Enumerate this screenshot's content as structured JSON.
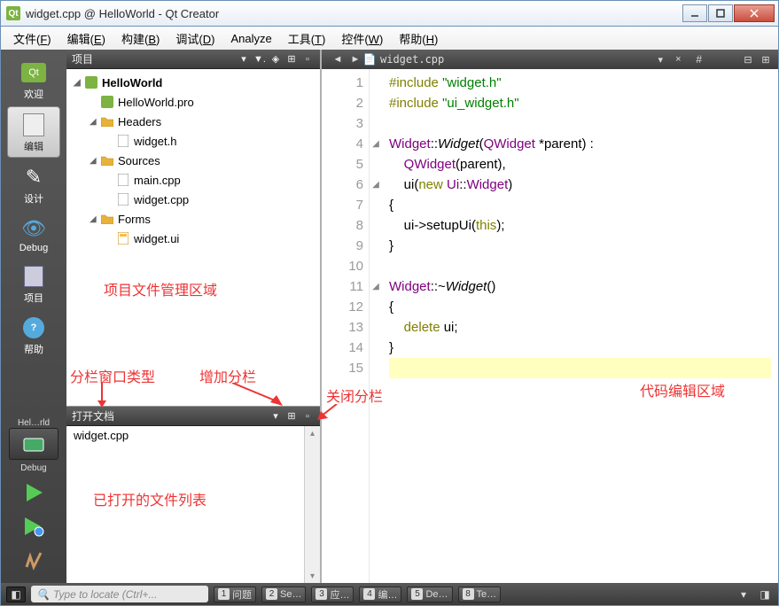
{
  "window": {
    "title": "widget.cpp @ HelloWorld - Qt Creator"
  },
  "menus": [
    {
      "label": "文件",
      "key": "F"
    },
    {
      "label": "编辑",
      "key": "E"
    },
    {
      "label": "构建",
      "key": "B"
    },
    {
      "label": "调试",
      "key": "D"
    },
    {
      "label": "Analyze",
      "key": ""
    },
    {
      "label": "工具",
      "key": "T"
    },
    {
      "label": "控件",
      "key": "W"
    },
    {
      "label": "帮助",
      "key": "H"
    }
  ],
  "modes": [
    {
      "id": "welcome",
      "label": "欢迎"
    },
    {
      "id": "edit",
      "label": "编辑",
      "active": true
    },
    {
      "id": "design",
      "label": "设计"
    },
    {
      "id": "debug",
      "label": "Debug"
    },
    {
      "id": "projects",
      "label": "项目"
    },
    {
      "id": "help",
      "label": "帮助"
    }
  ],
  "target": {
    "kit": "Hel…rld",
    "config": "Debug"
  },
  "project_pane": {
    "title": "项目",
    "tree": [
      {
        "lvl": 0,
        "exp": true,
        "icon": "qt",
        "label": "HelloWorld",
        "bold": true
      },
      {
        "lvl": 1,
        "exp": false,
        "icon": "pro",
        "label": "HelloWorld.pro"
      },
      {
        "lvl": 1,
        "exp": true,
        "icon": "folder",
        "label": "Headers"
      },
      {
        "lvl": 2,
        "exp": false,
        "icon": "h",
        "label": "widget.h"
      },
      {
        "lvl": 1,
        "exp": true,
        "icon": "folder",
        "label": "Sources"
      },
      {
        "lvl": 2,
        "exp": false,
        "icon": "cpp",
        "label": "main.cpp"
      },
      {
        "lvl": 2,
        "exp": false,
        "icon": "cpp",
        "label": "widget.cpp"
      },
      {
        "lvl": 1,
        "exp": true,
        "icon": "folder",
        "label": "Forms"
      },
      {
        "lvl": 2,
        "exp": false,
        "icon": "ui",
        "label": "widget.ui"
      }
    ]
  },
  "open_docs": {
    "title": "打开文档",
    "items": [
      "widget.cpp"
    ]
  },
  "annotations": {
    "proj_area": "项目文件管理区域",
    "pane_type": "分栏窗口类型",
    "add_split": "增加分栏",
    "close_split": "关闭分栏",
    "open_list": "已打开的文件列表",
    "code_area": "代码编辑区域"
  },
  "editor": {
    "filename": "widget.cpp",
    "hash": "#",
    "lines": [
      {
        "n": 1,
        "html": "<span class='kw'>#include</span> <span class='str'>\"widget.h\"</span>"
      },
      {
        "n": 2,
        "html": "<span class='kw'>#include</span> <span class='str'>\"ui_widget.h\"</span>"
      },
      {
        "n": 3,
        "html": ""
      },
      {
        "n": 4,
        "fold": true,
        "html": "<span class='type'>Widget</span>::<span class='fn'>Widget</span>(<span class='type'>QWidget</span> *parent) :"
      },
      {
        "n": 5,
        "html": "    <span class='type'>QWidget</span>(parent),"
      },
      {
        "n": 6,
        "fold": true,
        "html": "    ui(<span class='kw'>new</span> <span class='type'>Ui</span>::<span class='type'>Widget</span>)"
      },
      {
        "n": 7,
        "html": "{"
      },
      {
        "n": 8,
        "html": "    ui-&gt;setupUi(<span class='kw'>this</span>);"
      },
      {
        "n": 9,
        "html": "}"
      },
      {
        "n": 10,
        "html": ""
      },
      {
        "n": 11,
        "fold": true,
        "html": "<span class='type'>Widget</span>::~<span class='fn'>Widget</span>()"
      },
      {
        "n": 12,
        "html": "{"
      },
      {
        "n": 13,
        "html": "    <span class='kw'>delete</span> ui;"
      },
      {
        "n": 14,
        "html": "}"
      },
      {
        "n": 15,
        "cur": true,
        "html": ""
      }
    ]
  },
  "locator": {
    "placeholder": "Type to locate (Ctrl+..."
  },
  "output_panels": [
    {
      "n": "1",
      "label": "问题"
    },
    {
      "n": "2",
      "label": "Se…"
    },
    {
      "n": "3",
      "label": "应…"
    },
    {
      "n": "4",
      "label": "编…"
    },
    {
      "n": "5",
      "label": "De…"
    },
    {
      "n": "8",
      "label": "Te…"
    }
  ]
}
